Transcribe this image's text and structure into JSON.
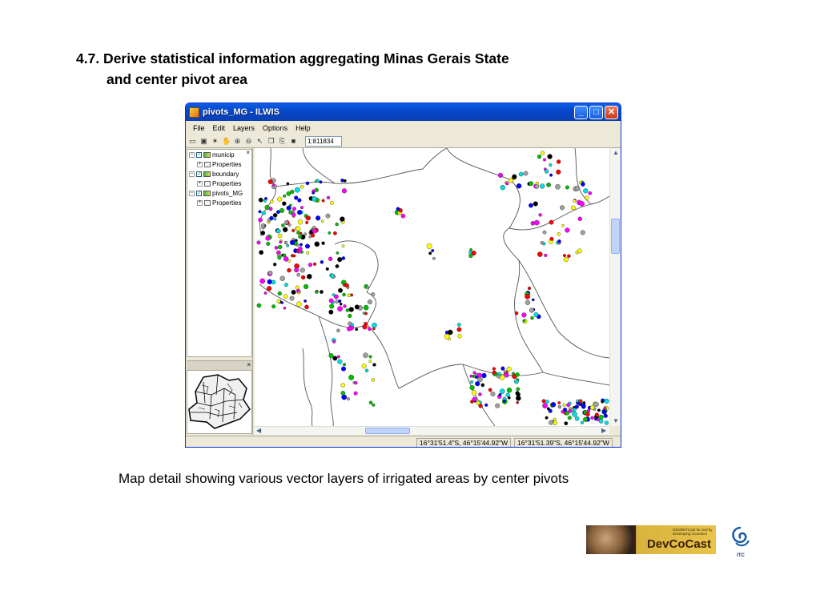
{
  "slide": {
    "title_line1": "4.7. Derive statistical information aggregating Minas Gerais State",
    "title_line2": "and  center pivot area",
    "caption": "Map detail showing various vector layers of irrigated areas by center pivots"
  },
  "window": {
    "title": "pivots_MG - ILWIS",
    "min_glyph": "_",
    "max_glyph": "□",
    "close_glyph": "✕"
  },
  "menu": [
    "File",
    "Edit",
    "Layers",
    "Options",
    "Help"
  ],
  "toolbar": {
    "scale": "1:811834"
  },
  "layers": {
    "close_glyph": "×",
    "items": [
      {
        "label": "municip",
        "type": "layer"
      },
      {
        "label": "Properties",
        "type": "prop"
      },
      {
        "label": "boundary",
        "type": "layer"
      },
      {
        "label": "Properties",
        "type": "prop"
      },
      {
        "label": "pivots_MG",
        "type": "layer"
      },
      {
        "label": "Properties",
        "type": "prop"
      }
    ]
  },
  "overview": {
    "close_glyph": "×"
  },
  "statusbar": {
    "coord1": "16°31'51.4\"S, 46°15'44.92\"W",
    "coord2": "16°31'51.39\"S, 46°15'44.92\"W"
  },
  "logos": {
    "devcocast_tag": "GEONETCast for and by Developing Countries",
    "devcocast_name": "DevCoCast",
    "itc_label": "ITC"
  },
  "colors": {
    "window_title_bar": "#0846c8",
    "pivot_colors": [
      "#ff00ff",
      "#00c000",
      "#0000ff",
      "#ffff00",
      "#00e0e0",
      "#000000",
      "#ff0000",
      "#a0a0a0"
    ]
  }
}
